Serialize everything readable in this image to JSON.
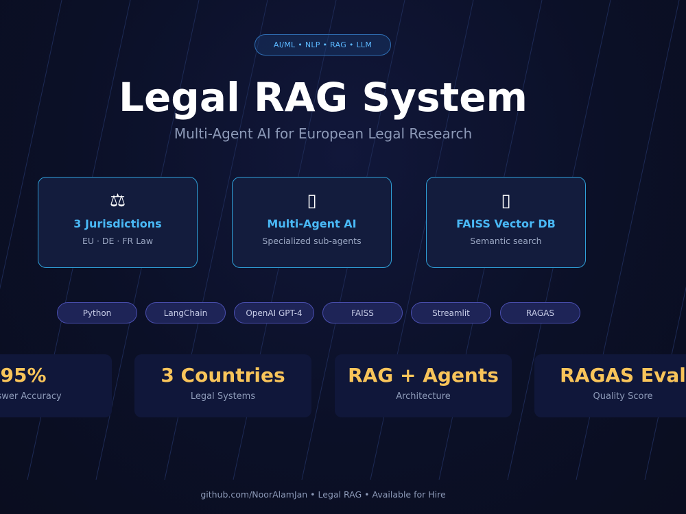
{
  "tags": "AI/ML  •  NLP  •  RAG  •  LLM",
  "title": "Legal RAG System",
  "subtitle": "Multi-Agent AI for European Legal Research",
  "cards": [
    {
      "icon": "scales-icon",
      "glyph": "⚖",
      "title": "3 Jurisdictions",
      "subtitle": "EU · DE · FR Law"
    },
    {
      "icon": "robot-icon",
      "glyph": "▯",
      "title": "Multi-Agent AI",
      "subtitle": "Specialized sub-agents"
    },
    {
      "icon": "search-icon",
      "glyph": "▯",
      "title": "FAISS Vector DB",
      "subtitle": "Semantic search"
    }
  ],
  "tech": [
    "Python",
    "LangChain",
    "OpenAI GPT-4",
    "FAISS",
    "Streamlit",
    "RAGAS"
  ],
  "stats": [
    {
      "value": "95%",
      "label": "Answer Accuracy"
    },
    {
      "value": "3 Countries",
      "label": "Legal Systems"
    },
    {
      "value": "RAG + Agents",
      "label": "Architecture"
    },
    {
      "value": "RAGAS Eval",
      "label": "Quality Score"
    }
  ],
  "footer": "github.com/NoorAlamJan  •  Legal RAG  •  Available for Hire",
  "colors": {
    "background": "#0b1027",
    "accent_blue": "#49b8f5",
    "accent_gold": "#f8c45a",
    "chip": "#1e2457"
  }
}
